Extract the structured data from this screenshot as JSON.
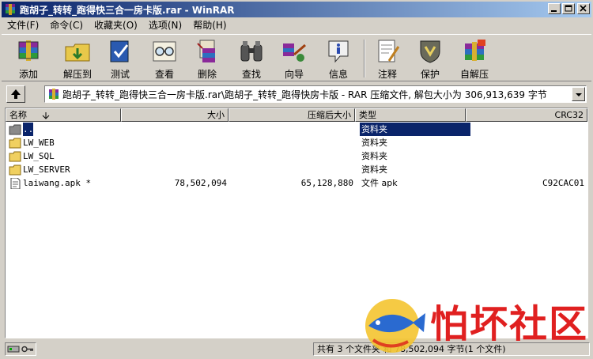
{
  "window": {
    "title": "跑胡子_转转_跑得快三合一房卡版.rar - WinRAR"
  },
  "menu": [
    "文件(F)",
    "命令(C)",
    "收藏夹(O)",
    "选项(N)",
    "帮助(H)"
  ],
  "toolbar": {
    "add": "添加",
    "extract_to": "解压到",
    "test": "测试",
    "view": "查看",
    "delete": "删除",
    "find": "查找",
    "wizard": "向导",
    "info": "信息",
    "comment": "注释",
    "protect": "保护",
    "sfx": "自解压"
  },
  "address": {
    "path": "跑胡子_转转_跑得快三合一房卡版.rar\\跑胡子_转转_跑得快房卡版 - RAR 压缩文件, 解包大小为 306,913,639 字节"
  },
  "columns": {
    "name": "名称",
    "size": "大小",
    "packed": "压缩后大小",
    "type": "类型",
    "crc": "CRC32"
  },
  "rows": [
    {
      "name": "..",
      "size": "",
      "packed": "",
      "type": "资料夹",
      "crc": "",
      "kind": "parent",
      "selected": true
    },
    {
      "name": "LW_WEB",
      "size": "",
      "packed": "",
      "type": "资料夹",
      "crc": "",
      "kind": "folder",
      "selected": false
    },
    {
      "name": "LW_SQL",
      "size": "",
      "packed": "",
      "type": "资料夹",
      "crc": "",
      "kind": "folder",
      "selected": false
    },
    {
      "name": "LW_SERVER",
      "size": "",
      "packed": "",
      "type": "资料夹",
      "crc": "",
      "kind": "folder",
      "selected": false
    },
    {
      "name": "laiwang.apk *",
      "size": "78,502,094",
      "packed": "65,128,880",
      "type": "文件 apk",
      "crc": "C92CAC01",
      "kind": "file",
      "selected": false
    }
  ],
  "status": {
    "summary": "共有 3 个文件夹 和 78,502,094 字节(1 个文件)"
  },
  "watermark": {
    "text": "怕坏社区"
  }
}
